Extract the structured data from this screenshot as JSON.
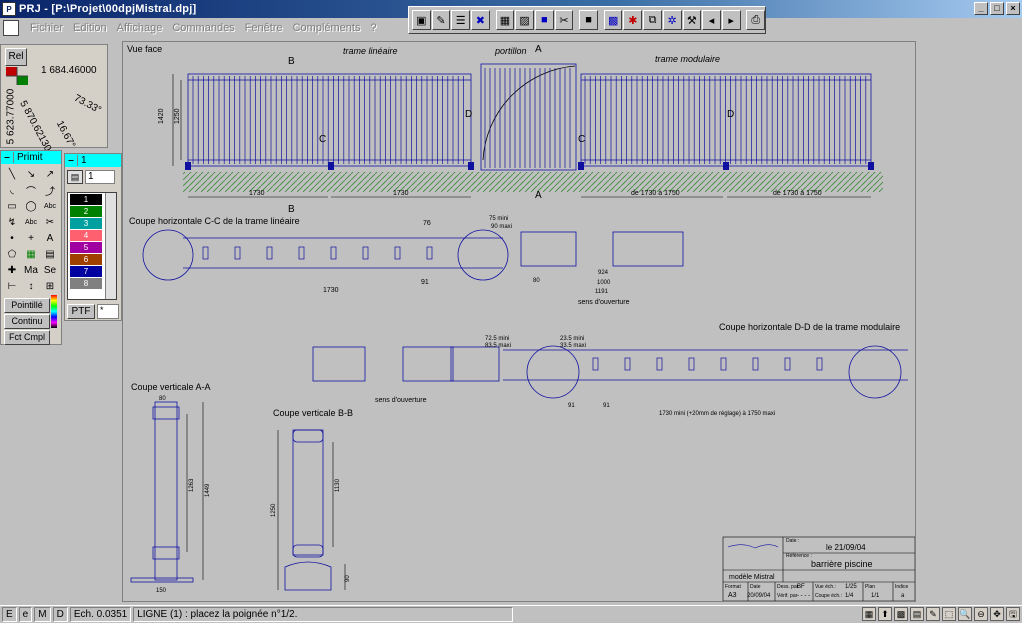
{
  "window": {
    "title": "PRJ - [P:\\Projet\\00dpjMistral.dpj]",
    "app_icon_text": "P",
    "controls": [
      "_",
      "□",
      "×"
    ]
  },
  "menus": [
    "Fichier",
    "Edition",
    "Affichage",
    "Commandes",
    "Fenêtre",
    "Compléments",
    "?"
  ],
  "toolbar": {
    "icons": [
      "select-icon",
      "edit-icon",
      "layers-icon",
      "close-icon",
      "film-icon",
      "color-icon",
      "blue-square-icon",
      "scissors-icon",
      "black-square-icon",
      "grid-icon",
      "tools-icon",
      "copy-icon",
      "puzzle-icon",
      "wrench-icon",
      "arrow-icon",
      "arrow-icon-2",
      "print-icon"
    ],
    "glyphs": [
      "▣",
      "✎",
      "☰",
      "✖",
      "▦",
      "▨",
      "■",
      "✂",
      "■",
      "▩",
      "✱",
      "⧉",
      "✲",
      "⚒",
      "◂",
      "▸",
      "⎙"
    ]
  },
  "coordinates": {
    "rel_label": "Rel",
    "x": "1 684.46000",
    "y": "5 623.77000",
    "diag1": "5 870.62130",
    "angle1": "73.33°",
    "angle2": "16.67°"
  },
  "primit_panel": {
    "minus": "–",
    "title": "Primit",
    "tools": [
      "╲",
      "↘",
      "↗",
      "◟",
      "⌒",
      "⤴",
      "▭",
      "◯",
      "Abc",
      "↯",
      "Abc",
      "✂",
      "•",
      "+",
      "A",
      "⬠",
      "▦",
      "▤",
      "✚",
      "Ma",
      "Se",
      "⊢",
      "↕",
      "⊞"
    ],
    "buttons": [
      "Pointillé",
      "Continu",
      "Fct Cmpl"
    ]
  },
  "layer_panel": {
    "minus": "–",
    "title": "1",
    "current": "1",
    "layers": [
      {
        "name": "1",
        "color": "#000000"
      },
      {
        "name": "2",
        "color": "#008000"
      },
      {
        "name": "3",
        "color": "#00a0a0"
      },
      {
        "name": "4",
        "color": "#ff6070"
      },
      {
        "name": "5",
        "color": "#a000a0"
      },
      {
        "name": "6",
        "color": "#a04000"
      },
      {
        "name": "7",
        "color": "#0000a0"
      },
      {
        "name": "8",
        "color": "#808080"
      }
    ],
    "ptf_label": "PTF",
    "ptf_value": "*"
  },
  "drawing": {
    "vue_face": "Vue face",
    "trame_lineaire": "trame linéaire",
    "portillon": "portillon",
    "trame_modulaire": "trame modulaire",
    "coupe_cc": "Coupe horizontale C-C de la trame linéaire",
    "coupe_dd": "Coupe horizontale D-D de la trame modulaire",
    "coupe_aa": "Coupe verticale A-A",
    "coupe_bb": "Coupe verticale B-B",
    "sens_ouverture": "sens d'ouverture",
    "dim_1730": "1730",
    "dim_1730_1750": "de 1730 à 1750",
    "dim_1730_mini": "1730 mini (+20mm de réglage) à 1750 maxi",
    "dim_76": "76",
    "dim_91": "91",
    "dim_80": "80",
    "dim_1000": "1000",
    "dim_924": "924",
    "dim_1191": "1191",
    "dim_150": "150",
    "dim_1449": "1449",
    "dim_1263": "1263",
    "dim_1130": "1130",
    "dim_1250": "1250",
    "dim_90": "90",
    "dim_1420": "1420",
    "dim_1250v": "1250",
    "dim_75mini": "75 mini",
    "dim_90maxi": "90 maxi",
    "dim_725mini": "72.5 mini",
    "dim_835maxi": "83.5 maxi",
    "dim_235mini": "23.5 mini",
    "dim_335maxi": "33.5 maxi",
    "letter_a": "A",
    "letter_b": "B",
    "letter_c": "C",
    "letter_d": "D",
    "titleblock": {
      "date_label": "Date :",
      "date": "le 21/09/04",
      "ref_label": "Référence :",
      "ref": "barrière piscine",
      "modele": "modèle Mistral",
      "format_label": "Format",
      "format": "A3",
      "date2_label": "Date",
      "date2": "20/09/04",
      "dess_label": "Dess. par",
      "dess": "BF",
      "verif_label": "Vérif. par",
      "verif": "- - - -",
      "ech_label": "Vue éch.:",
      "ech": "1/25",
      "coupe_ech_label": "Coupe éch.:",
      "coupe_ech": "1/4",
      "plan_label": "Plan",
      "plan": "1/1",
      "indice_label": "Indice",
      "indice": "a"
    }
  },
  "status": {
    "modes": [
      "E",
      "e",
      "M",
      "D"
    ],
    "scale": "Ech. 0.0351",
    "message": "LIGNE (1) : placez la poignée n°1/2.",
    "icons": [
      "palette-icon",
      "cursor-icon",
      "grid-icon",
      "hatch-icon",
      "pen-icon",
      "zoom-window-icon",
      "zoom-icon",
      "zoom-out-icon",
      "pan-icon",
      "save-icon"
    ],
    "glyphs": [
      "▦",
      "⬆",
      "▩",
      "▤",
      "✎",
      "⬚",
      "🔍",
      "⊖",
      "✥",
      "🖫"
    ]
  }
}
